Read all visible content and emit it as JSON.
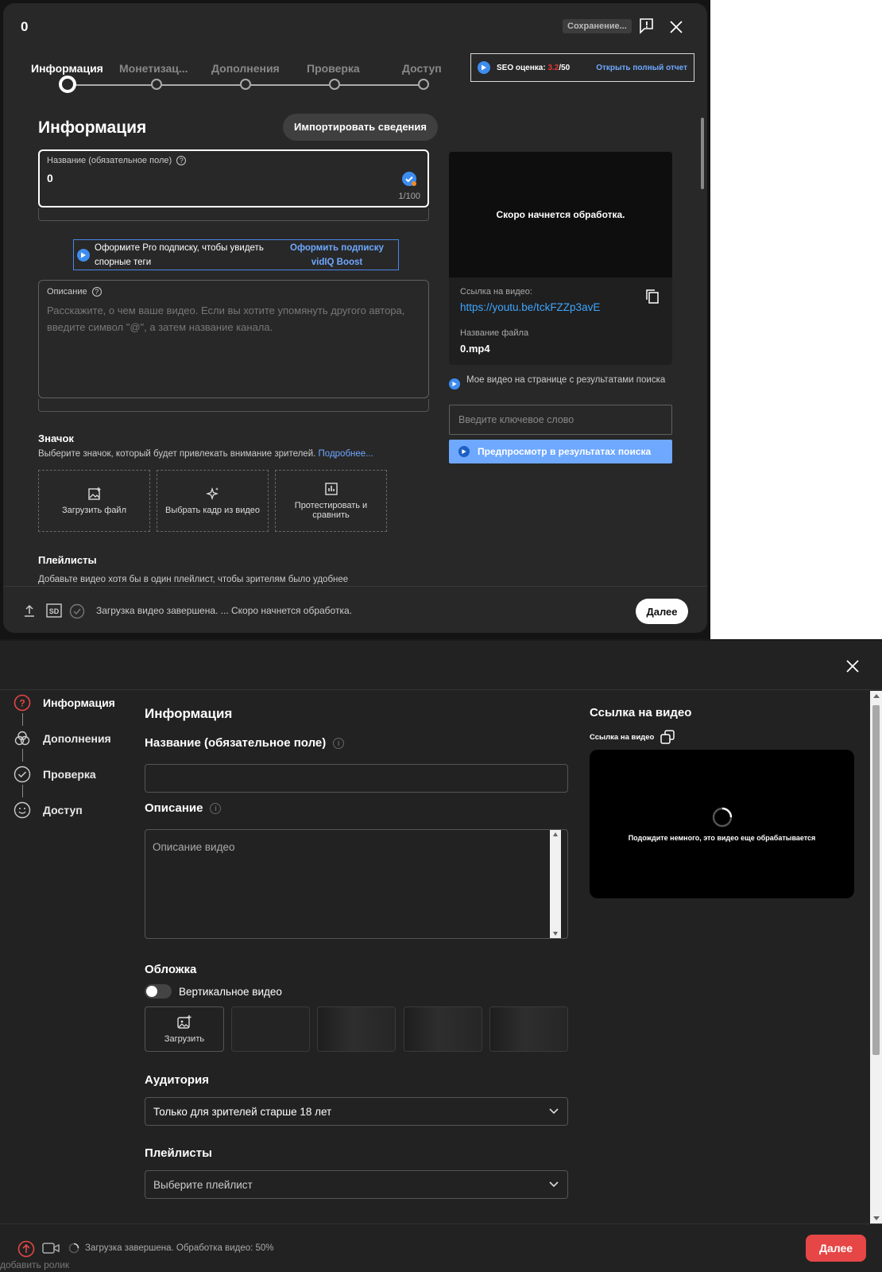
{
  "youtube_dialog": {
    "title": "0",
    "saving_chip": "Сохранение...",
    "steps": [
      "Информация",
      "Монетизац...",
      "Дополнения",
      "Проверка",
      "Доступ"
    ],
    "seo": {
      "label": "SEO оценка:",
      "score": "3.2",
      "max": "/50",
      "link": "Открыть полный отчет"
    },
    "section_title": "Информация",
    "import_button": "Импортировать сведения",
    "title_field": {
      "label": "Название (обязательное поле)",
      "value": "0",
      "counter": "1/100"
    },
    "pro_banner": {
      "text": "Оформите Pro подписку, чтобы увидеть спорные теги",
      "link": "Оформить подписку vidIQ Boost"
    },
    "description_field": {
      "label": "Описание",
      "placeholder": "Расскажите, о чем ваше видео. Если вы хотите упомянуть другого автора, введите символ \"@\", а затем название канала."
    },
    "thumbnail": {
      "title": "Значок",
      "desc": "Выберите значок, который будет привлекать внимание зрителей.",
      "more": "Подробнее...",
      "options": [
        "Загрузить файл",
        "Выбрать кадр из видео",
        "Протестировать и сравнить"
      ]
    },
    "playlists": {
      "title": "Плейлисты",
      "desc": "Добавьте видео хотя бы в один плейлист, чтобы зрителям было удобнее"
    },
    "preview": {
      "processing": "Скоро начнется обработка.",
      "link_label": "Ссылка на видео:",
      "link_value": "https://youtu.be/tckFZZp3avE",
      "filename_label": "Название файла",
      "filename_value": "0.mp4"
    },
    "search_preview": {
      "text": "Мое видео на странице с результатами поиска",
      "keyword_placeholder": "Введите ключевое слово",
      "button": "Предпросмотр в результатах поиска"
    },
    "footer": {
      "sd_badge": "SD",
      "status": "Загрузка видео завершена. ... Скоро начнется обработка.",
      "next": "Далее"
    }
  },
  "vk_dialog": {
    "nav": [
      "Информация",
      "Дополнения",
      "Проверка",
      "Доступ"
    ],
    "section_title": "Информация",
    "title_label": "Название (обязательное поле)",
    "description_label": "Описание",
    "description_placeholder": "Описание видео",
    "cover_label": "Обложка",
    "vertical_toggle": "Вертикальное видео",
    "upload_button": "Загрузить",
    "audience_label": "Аудитория",
    "audience_value": "Только для зрителей старше 18 лет",
    "playlists_label": "Плейлисты",
    "playlists_placeholder": "Выберите плейлист",
    "link_title": "Ссылка на видео",
    "link_sub": "Ссылка на видео",
    "player_text": "Подождите немного, это видео еще обрабатывается",
    "footer": {
      "status": "Загрузка завершена. Обработка видео: 50%",
      "next": "Далее"
    },
    "behind_text": "добавить ролик"
  },
  "colors": {
    "youtube_blue": "#3ea6ff",
    "vidiq_blue": "#6ea8ff",
    "vk_red": "#e64646",
    "seo_score_red": "#e53935"
  }
}
